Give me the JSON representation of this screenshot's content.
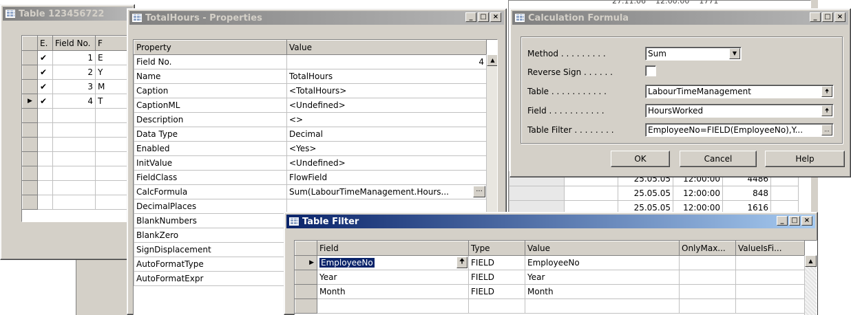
{
  "table_window": {
    "title": "Table 123456722",
    "columns": [
      "E.",
      "Field No.",
      "F"
    ],
    "rows": [
      {
        "enabled": "✔",
        "no": "1",
        "name": "E"
      },
      {
        "enabled": "✔",
        "no": "2",
        "name": "Y"
      },
      {
        "enabled": "✔",
        "no": "3",
        "name": "M"
      },
      {
        "enabled": "✔",
        "no": "4",
        "name": "T"
      }
    ]
  },
  "properties_window": {
    "title": "TotalHours - Properties",
    "col_property": "Property",
    "col_value": "Value",
    "rows": [
      {
        "p": "Field No.",
        "v": "4"
      },
      {
        "p": "Name",
        "v": "TotalHours"
      },
      {
        "p": "Caption",
        "v": "<TotalHours>"
      },
      {
        "p": "CaptionML",
        "v": "<Undefined>"
      },
      {
        "p": "Description",
        "v": "<>"
      },
      {
        "p": "Data Type",
        "v": "Decimal"
      },
      {
        "p": "Enabled",
        "v": "<Yes>"
      },
      {
        "p": "InitValue",
        "v": "<Undefined>"
      },
      {
        "p": "FieldClass",
        "v": "FlowField"
      },
      {
        "p": "CalcFormula",
        "v": "Sum(LabourTimeManagement.Hours..."
      },
      {
        "p": "DecimalPlaces",
        "v": ""
      },
      {
        "p": "BlankNumbers",
        "v": ""
      },
      {
        "p": "BlankZero",
        "v": ""
      },
      {
        "p": "SignDisplacement",
        "v": ""
      },
      {
        "p": "AutoFormatType",
        "v": ""
      },
      {
        "p": "AutoFormatExpr",
        "v": ""
      }
    ]
  },
  "background_grid": {
    "rows": [
      {
        "date": "25.05.05",
        "time": "12:00:00",
        "val": "4486"
      },
      {
        "date": "25.05.05",
        "time": "12:00:00",
        "val": "848"
      },
      {
        "date": "25.05.05",
        "time": "12:00:00",
        "val": "1616"
      }
    ],
    "top_partial": [
      "27.11.06",
      "12:00:00",
      "1771"
    ]
  },
  "calc_window": {
    "title": "Calculation Formula",
    "method_label": "Method . . . . . . . . .",
    "method_value": "Sum",
    "reverse_label": "Reverse Sign . . . . . .",
    "table_label": "Table . . . . . . . . . . .",
    "table_value": "LabourTimeManagement",
    "field_label": "Field . . . . . . . . . . .",
    "field_value": "HoursWorked",
    "filter_label": "Table Filter . . . . . . . .",
    "filter_value": "EmployeeNo=FIELD(EmployeeNo),Y...",
    "ok": "OK",
    "cancel": "Cancel",
    "help": "Help"
  },
  "filter_window": {
    "title": "Table Filter",
    "columns": [
      "Field",
      "Type",
      "Value",
      "OnlyMax...",
      "ValueIsFi..."
    ],
    "rows": [
      {
        "field": "EmployeeNo",
        "type": "FIELD",
        "value": "EmployeeNo"
      },
      {
        "field": "Year",
        "type": "FIELD",
        "value": "Year"
      },
      {
        "field": "Month",
        "type": "FIELD",
        "value": "Month"
      }
    ]
  },
  "colors": {
    "active_title": "#0a246a",
    "inactive_title": "#808080",
    "face": "#d4d0c8"
  }
}
